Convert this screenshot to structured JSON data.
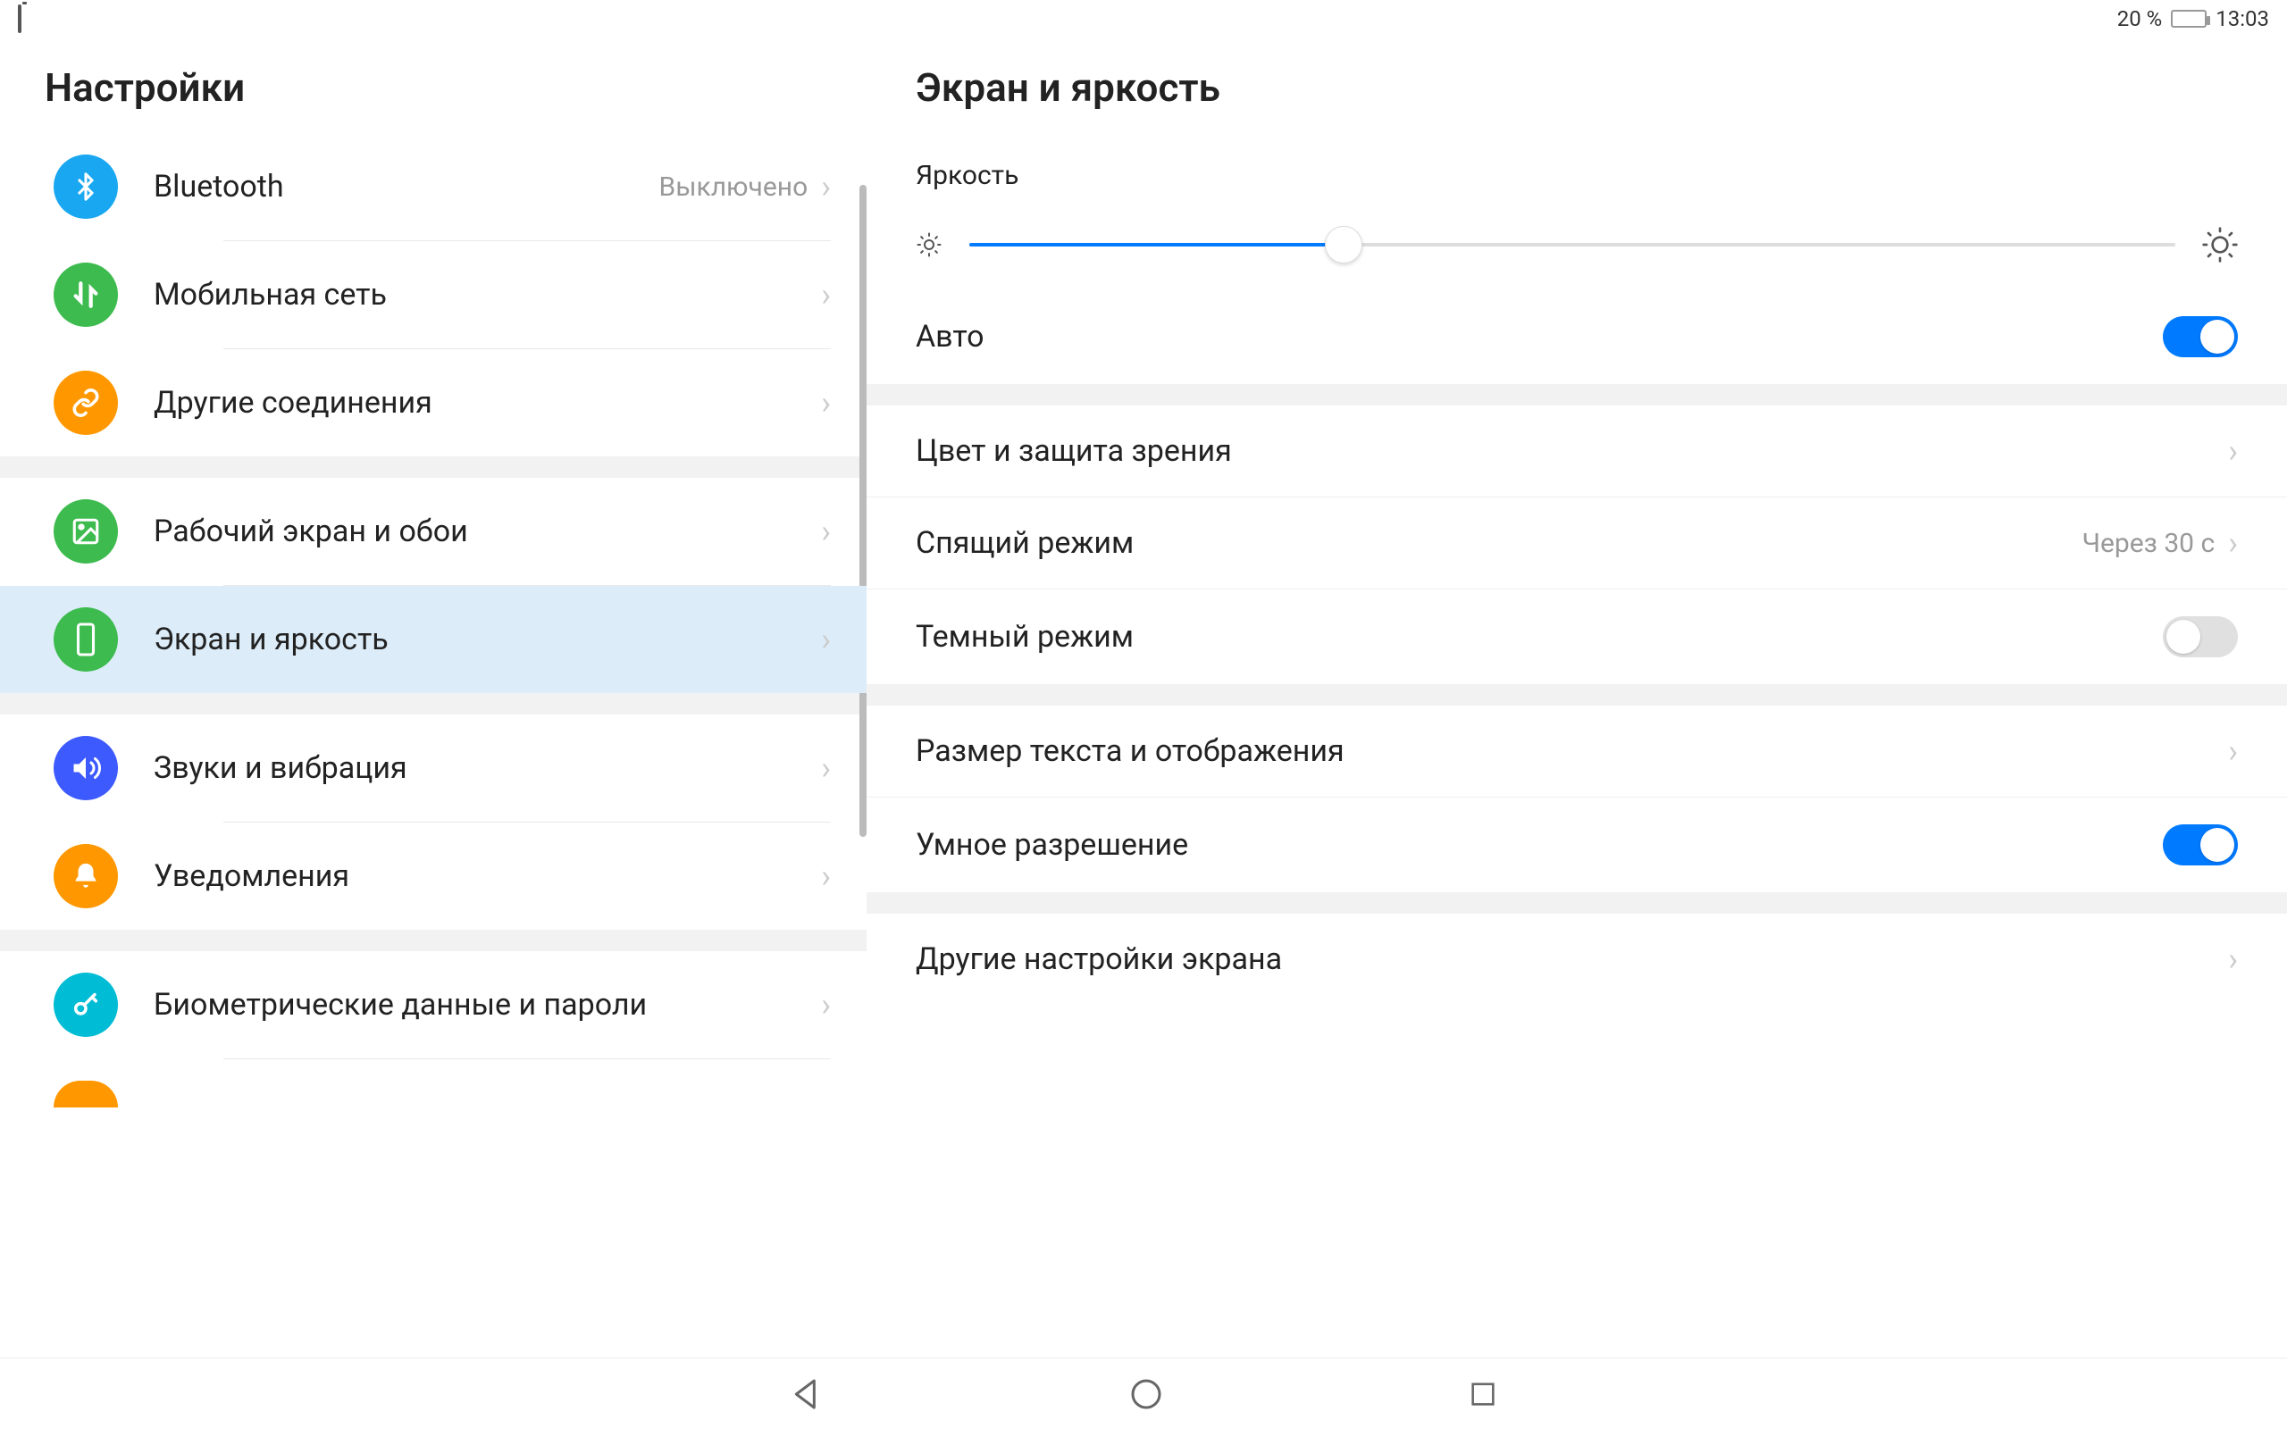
{
  "status": {
    "battery_pct": "20 %",
    "time": "13:03"
  },
  "sidebar": {
    "title": "Настройки",
    "items": [
      {
        "label": "Bluetooth",
        "value": "Выключено"
      },
      {
        "label": "Мобильная сеть"
      },
      {
        "label": "Другие соединения"
      },
      {
        "label": "Рабочий экран и обои"
      },
      {
        "label": "Экран и яркость"
      },
      {
        "label": "Звуки и вибрация"
      },
      {
        "label": "Уведомления"
      },
      {
        "label": "Биометрические данные и пароли"
      }
    ]
  },
  "main": {
    "title": "Экран и яркость",
    "brightness_label": "Яркость",
    "brightness_pct": 31,
    "auto_label": "Авто",
    "auto_on": true,
    "rows": {
      "color": "Цвет и защита зрения",
      "sleep": "Спящий режим",
      "sleep_value": "Через 30 с",
      "dark": "Темный режим",
      "dark_on": false,
      "text_size": "Размер текста и отображения",
      "smart_res": "Умное разрешение",
      "smart_res_on": true,
      "other": "Другие настройки экрана"
    }
  }
}
